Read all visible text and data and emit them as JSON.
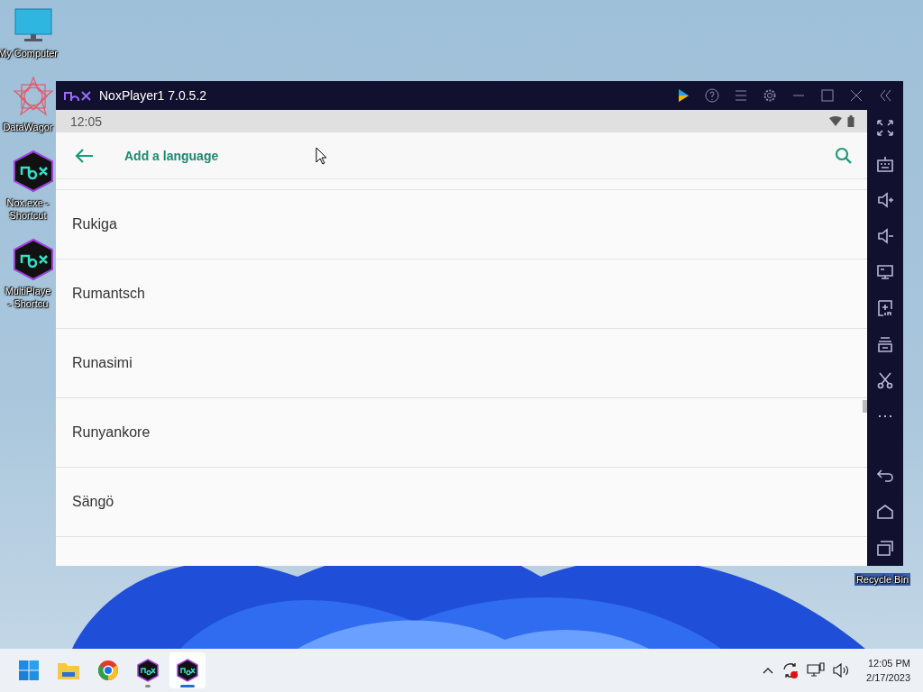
{
  "desktop": {
    "icons": [
      {
        "kind": "monitor",
        "lines": [
          "My Computer"
        ]
      },
      {
        "kind": "star",
        "lines": [
          "DataWagor"
        ]
      },
      {
        "kind": "nox",
        "lines": [
          "Nox.exe -",
          "Shortcut"
        ]
      },
      {
        "kind": "nox",
        "lines": [
          "MultiPlaye",
          "- Shortcu"
        ]
      }
    ],
    "recycle_bin": {
      "label": "Recycle Bin"
    }
  },
  "window": {
    "title": "NoxPlayer1 7.0.5.2"
  },
  "android": {
    "status_time": "12:05",
    "app_bar": {
      "title": "Add a language"
    },
    "languages": [
      {
        "name": "Rukiga"
      },
      {
        "name": "Rumantsch"
      },
      {
        "name": "Runasimi"
      },
      {
        "name": "Runyankore"
      },
      {
        "name": "Sängö"
      }
    ]
  },
  "taskbar": {
    "apps": [
      {
        "kind": "start",
        "running": false,
        "selected": false
      },
      {
        "kind": "folder",
        "running": false,
        "selected": false
      },
      {
        "kind": "chrome",
        "running": false,
        "selected": false
      },
      {
        "kind": "nox",
        "running": true,
        "selected": false
      },
      {
        "kind": "nox",
        "running": true,
        "selected": true
      }
    ],
    "clock": {
      "time": "12:05 PM",
      "date": "2/17/2023"
    }
  }
}
